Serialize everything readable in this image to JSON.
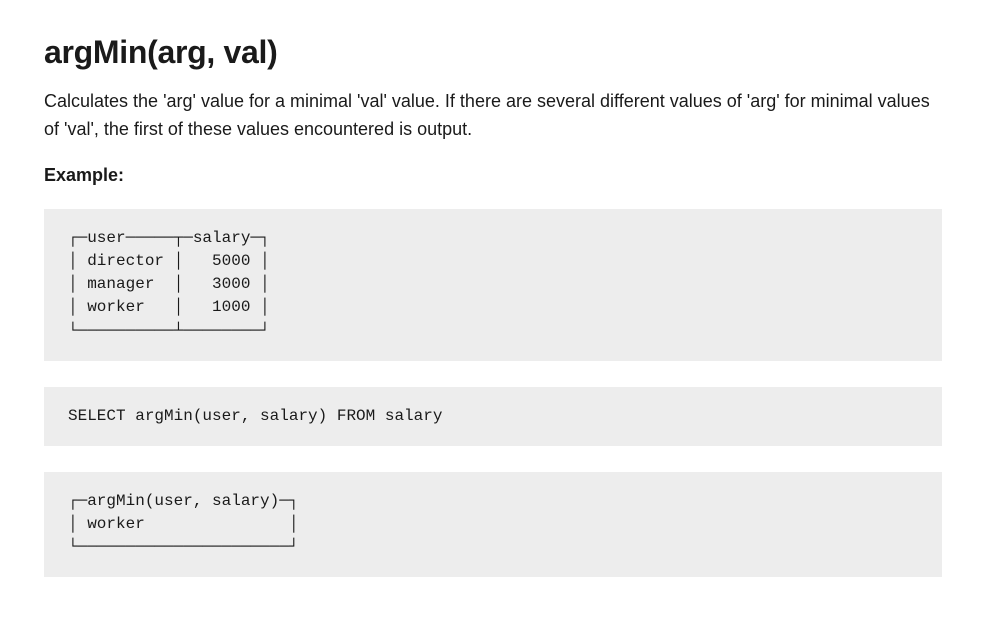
{
  "heading": "argMin(arg, val)",
  "description": "Calculates the 'arg' value for a minimal 'val' value. If there are several different values of 'arg' for minimal values of 'val', the first of these values encountered is output.",
  "exampleLabel": "Example:",
  "codeBlock1": "┌─user─────┬─salary─┐\n│ director │   5000 │\n│ manager  │   3000 │\n│ worker   │   1000 │\n└──────────┴────────┘",
  "codeBlock2": "SELECT argMin(user, salary) FROM salary",
  "codeBlock3": "┌─argMin(user, salary)─┐\n│ worker               │\n└──────────────────────┘"
}
